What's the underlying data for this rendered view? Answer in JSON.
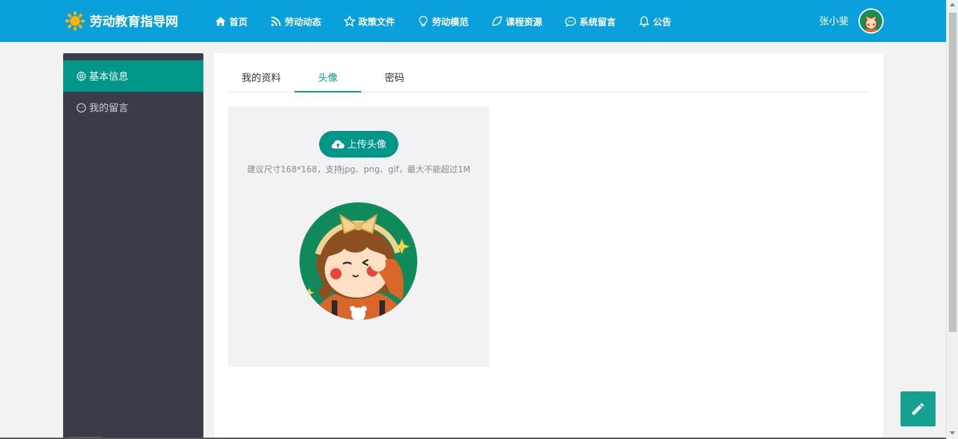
{
  "brand": {
    "title": "劳动教育指导网",
    "icon": "sun-icon"
  },
  "nav": {
    "items": [
      {
        "label": "首页",
        "icon": "home-icon"
      },
      {
        "label": "劳动动态",
        "icon": "rss-icon"
      },
      {
        "label": "政策文件",
        "icon": "star-icon"
      },
      {
        "label": "劳动模范",
        "icon": "lightbulb-icon"
      },
      {
        "label": "课程资源",
        "icon": "leaf-icon"
      },
      {
        "label": "系统留言",
        "icon": "chat-icon"
      },
      {
        "label": "公告",
        "icon": "bell-icon"
      }
    ]
  },
  "user": {
    "name": "张小斐"
  },
  "sidebar": {
    "items": [
      {
        "label": "基本信息",
        "icon": "gear-icon",
        "active": true
      },
      {
        "label": "我的留言",
        "icon": "message-face-icon",
        "active": false
      }
    ]
  },
  "tabs": [
    {
      "label": "我的资料"
    },
    {
      "label": "头像"
    },
    {
      "label": "密码"
    }
  ],
  "upload": {
    "button_label": "上传头像",
    "hint": "建议尺寸168*168，支持jpg、png、gif，最大不能超过1M"
  },
  "colors": {
    "topbar": "#0aa0dc",
    "accent": "#009688",
    "sidebar": "#393d49"
  }
}
